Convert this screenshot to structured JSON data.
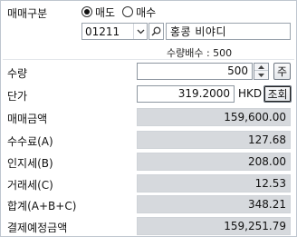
{
  "trade_type": {
    "label": "매매구분",
    "options": [
      "매도",
      "매수"
    ],
    "selected": "매도"
  },
  "stock": {
    "code": "01211",
    "name": "홍콩   비야디",
    "multiple_label": "수량배수 : 500"
  },
  "quantity": {
    "label": "수량",
    "value": "500",
    "button": "주"
  },
  "price": {
    "label": "단가",
    "value": "319.2000",
    "currency": "HKD",
    "button": "조회"
  },
  "summary": {
    "trade_amount": {
      "label": "매매금액",
      "value": "159,600.00"
    },
    "commission": {
      "label": "수수료(A)",
      "value": "127.68"
    },
    "stamp_tax": {
      "label": "인지세(B)",
      "value": "208.00"
    },
    "exchange_fee": {
      "label": "거래세(C)",
      "value": "12.53"
    },
    "total": {
      "label": "합계(A+B+C)",
      "value": "348.21"
    },
    "settlement": {
      "label": "결제예정금액",
      "value": "159,251.79"
    }
  },
  "icons": {
    "dropdown": "chevron-down-icon",
    "search": "search-icon",
    "spin_up": "spin-up-icon",
    "spin_down": "spin-down-icon"
  }
}
